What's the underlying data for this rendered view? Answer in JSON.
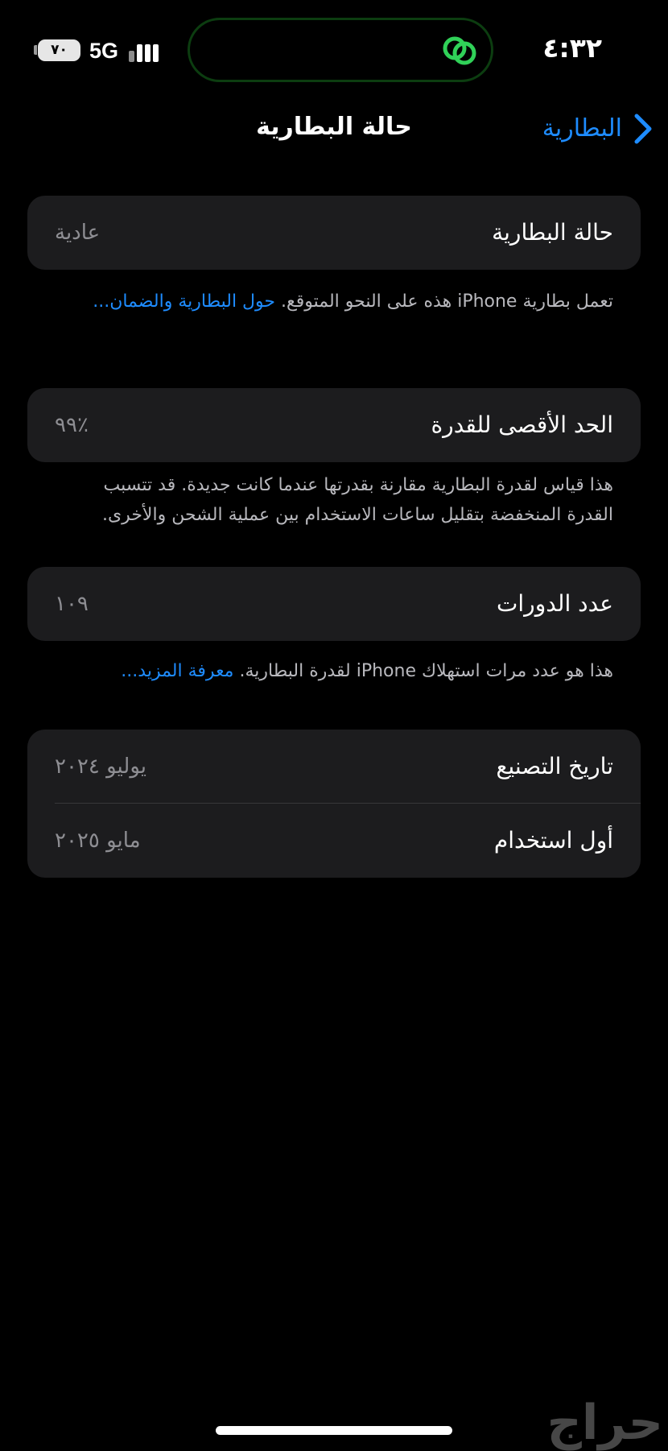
{
  "status_bar": {
    "time": "٤:٣٢",
    "battery_level": "٧٠",
    "network": "5G",
    "island_icon": "link-rings-icon",
    "island_accent": "#30d158"
  },
  "nav": {
    "back_label": "البطارية",
    "title": "حالة البطارية",
    "accent": "#1e8cff"
  },
  "battery_condition": {
    "label": "حالة البطارية",
    "value": "عادية",
    "footnote": "تعمل بطارية iPhone هذه على النحو المتوقع.",
    "footnote_link": "حول البطارية والضمان..."
  },
  "max_capacity": {
    "label": "الحد الأقصى للقدرة",
    "value": "٪٩٩",
    "footnote": "هذا قياس لقدرة البطارية مقارنة بقدرتها عندما كانت جديدة. قد تتسبب القدرة المنخفضة بتقليل ساعات الاستخدام بين عملية الشحن والأخرى."
  },
  "cycle_count": {
    "label": "عدد الدورات",
    "value": "١٠٩",
    "footnote": "هذا هو عدد مرات استهلاك iPhone لقدرة البطارية.",
    "footnote_link": "معرفة المزيد..."
  },
  "dates": [
    {
      "label": "تاريخ التصنيع",
      "value": "يوليو ٢٠٢٤"
    },
    {
      "label": "أول استخدام",
      "value": "مايو ٢٠٢٥"
    }
  ],
  "watermark": "حراج"
}
